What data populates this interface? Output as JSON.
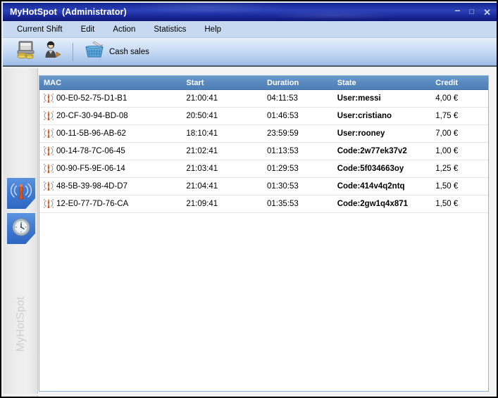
{
  "window": {
    "title": "MyHotSpot  (Administrator)",
    "buttons": {
      "minimize": "–",
      "maximize": "□",
      "close": "✕"
    }
  },
  "menubar": {
    "items": [
      {
        "label": "Current Shift"
      },
      {
        "label": "Edit"
      },
      {
        "label": "Action"
      },
      {
        "label": "Statistics"
      },
      {
        "label": "Help"
      }
    ]
  },
  "toolbar": {
    "buttons": [
      {
        "name": "cash-register-icon",
        "label": ""
      },
      {
        "name": "user-logout-icon",
        "label": ""
      },
      {
        "name": "cash-sales-basket-icon",
        "label": "Cash sales"
      }
    ],
    "cash_sales_label": "Cash sales"
  },
  "sidebar": {
    "vertical_label": "MyHotSpot",
    "tabs": [
      {
        "name": "hotspot-antenna-tab",
        "label": ""
      },
      {
        "name": "shift-clock-tab",
        "label": ""
      }
    ]
  },
  "table": {
    "columns": [
      {
        "key": "mac",
        "label": "MAC"
      },
      {
        "key": "start",
        "label": "Start"
      },
      {
        "key": "duration",
        "label": "Duration"
      },
      {
        "key": "state",
        "label": "State"
      },
      {
        "key": "credit",
        "label": "Credit"
      }
    ],
    "rows": [
      {
        "mac": "00-E0-52-75-D1-B1",
        "start": "21:00:41",
        "duration": "04:11:53",
        "state": "User:messi",
        "credit": "4,00 €"
      },
      {
        "mac": "20-CF-30-94-BD-08",
        "start": "20:50:41",
        "duration": "01:46:53",
        "state": "User:cristiano",
        "credit": "1,75 €"
      },
      {
        "mac": "00-11-5B-96-AB-62",
        "start": "18:10:41",
        "duration": "23:59:59",
        "state": "User:rooney",
        "credit": "7,00 €"
      },
      {
        "mac": "00-14-78-7C-06-45",
        "start": "21:02:41",
        "duration": "01:13:53",
        "state": "Code:2w77ek37v2",
        "credit": "1,00 €"
      },
      {
        "mac": "00-90-F5-9E-06-14",
        "start": "21:03:41",
        "duration": "01:29:53",
        "state": "Code:5f034663oy",
        "credit": "1,25 €"
      },
      {
        "mac": "48-5B-39-98-4D-D7",
        "start": "21:04:41",
        "duration": "01:30:53",
        "state": "Code:414v4q2ntq",
        "credit": "1,50 €"
      },
      {
        "mac": "12-E0-77-7D-76-CA",
        "start": "21:09:41",
        "duration": "01:35:53",
        "state": "Code:2gw1q4x871",
        "credit": "1,50 €"
      }
    ]
  },
  "colors": {
    "titlebar": "#1c2fa0",
    "menubar": "#c6d9f0",
    "toolbar_top": "#e8f0fb",
    "toolbar_bottom": "#9bbbe5",
    "grid_header": "#5888bd",
    "tab_blue": "#3f7ad2",
    "antenna_orange": "#d9541e",
    "basket_blue": "#4e9bd6"
  }
}
